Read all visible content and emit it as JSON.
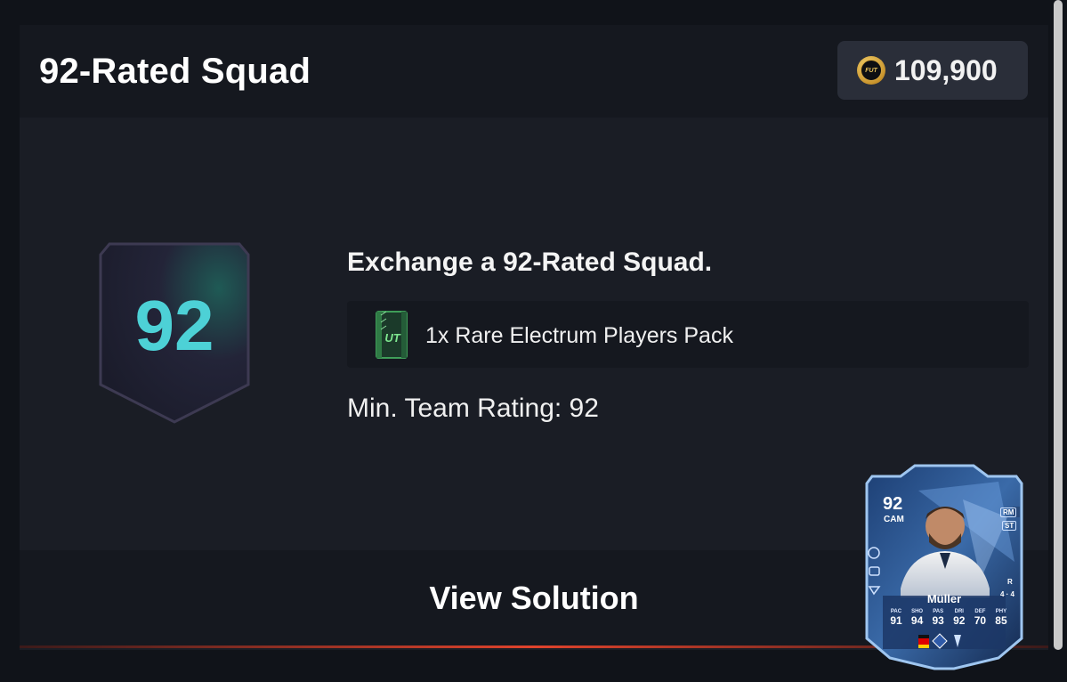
{
  "header": {
    "title": "92-Rated Squad",
    "coins_icon_text": "FUT",
    "coins_value": "109,900"
  },
  "badge": {
    "rating": "92"
  },
  "challenge": {
    "title": "Exchange a 92-Rated Squad.",
    "reward_label": "1x Rare Electrum Players Pack",
    "pack_icon_text": "UT",
    "requirement": "Min. Team Rating: 92"
  },
  "footer": {
    "button_label": "View Solution"
  },
  "player_card": {
    "rating": "92",
    "position": "CAM",
    "alt_positions": [
      "RM",
      "ST"
    ],
    "name": "Müller",
    "foot": "R",
    "skills_weakfoot": "4 · 4",
    "stat_labels": [
      "PAC",
      "SHO",
      "PAS",
      "DRI",
      "DEF",
      "PHY"
    ],
    "stat_values": [
      "91",
      "94",
      "93",
      "92",
      "70",
      "85"
    ]
  },
  "colors": {
    "background": "#101319",
    "panel": "#1a1d25",
    "coin_pill": "#2a2e39",
    "badge_number": "#4dd1d6",
    "accent_line": "#e0432c"
  }
}
